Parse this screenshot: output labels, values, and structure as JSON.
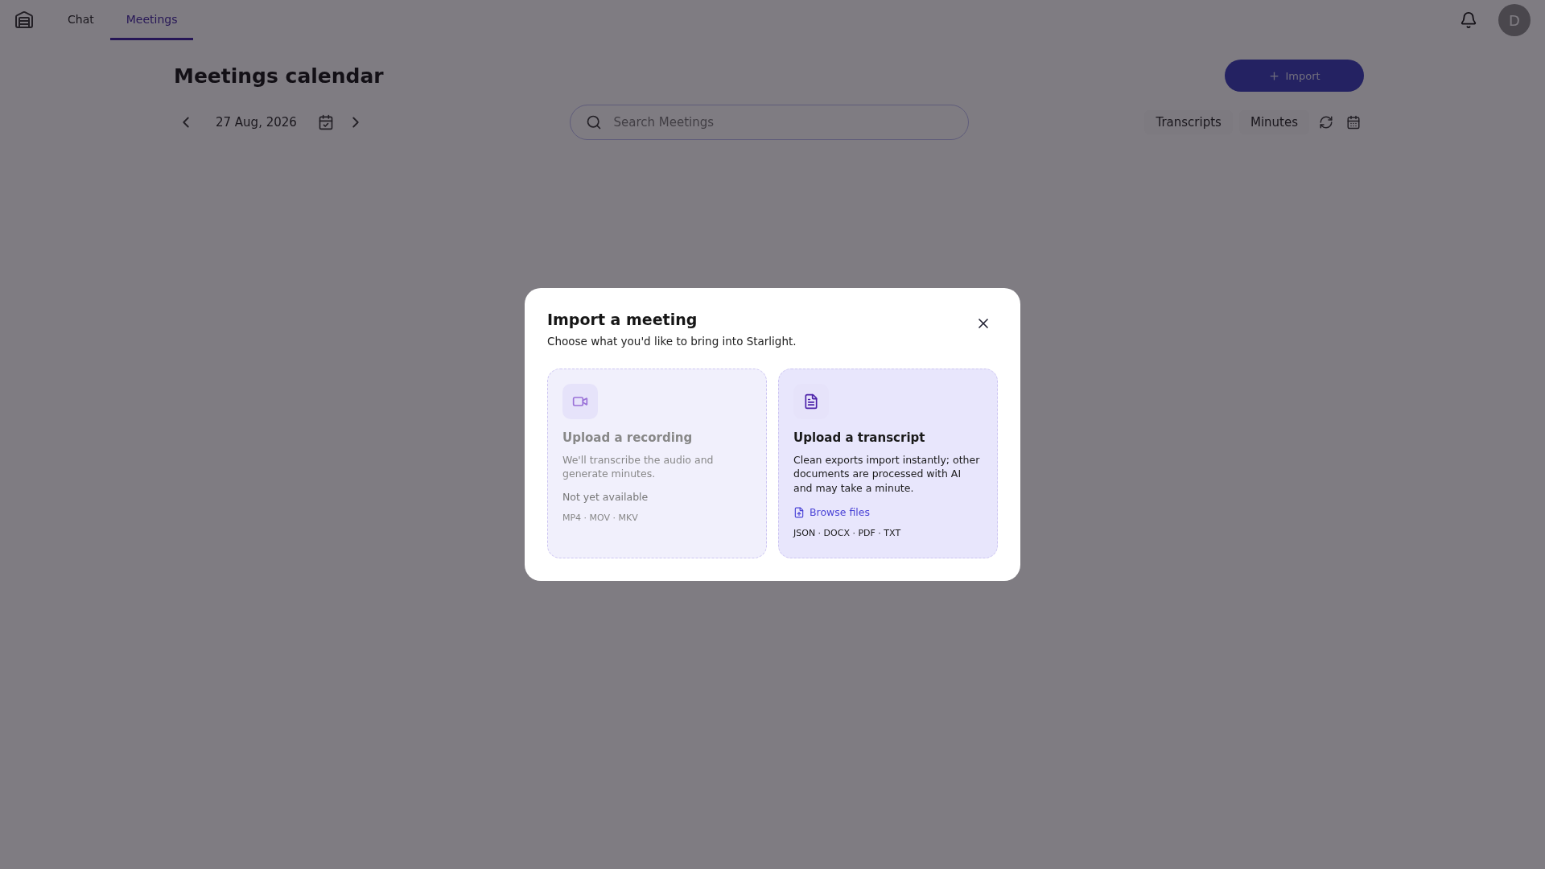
{
  "nav": {
    "tabs": [
      {
        "label": "Chat",
        "selected": false
      },
      {
        "label": "Meetings",
        "selected": true
      }
    ],
    "avatar": "D"
  },
  "page": {
    "title": "Meetings calendar",
    "import_button": "Import",
    "date": "27 Aug, 2026",
    "search": {
      "placeholder": "Search Meetings"
    },
    "views": [
      "Transcripts",
      "Minutes"
    ]
  },
  "dialog": {
    "title": "Import a meeting",
    "subtitle": "Choose what you'd like to bring into Starlight.",
    "options": [
      {
        "kind": "recording",
        "disabled": true,
        "title": "Upload a recording",
        "description": "We'll transcribe the audio and generate minutes.",
        "note": "Not yet available",
        "formats": "MP4 · MOV · MKV"
      },
      {
        "kind": "transcript",
        "disabled": false,
        "title": "Upload a transcript",
        "description": "Clean exports import instantly; other documents are processed with AI and may take a minute.",
        "link": "Browse files",
        "formats": "JSON · DOCX · PDF · TXT"
      }
    ]
  }
}
